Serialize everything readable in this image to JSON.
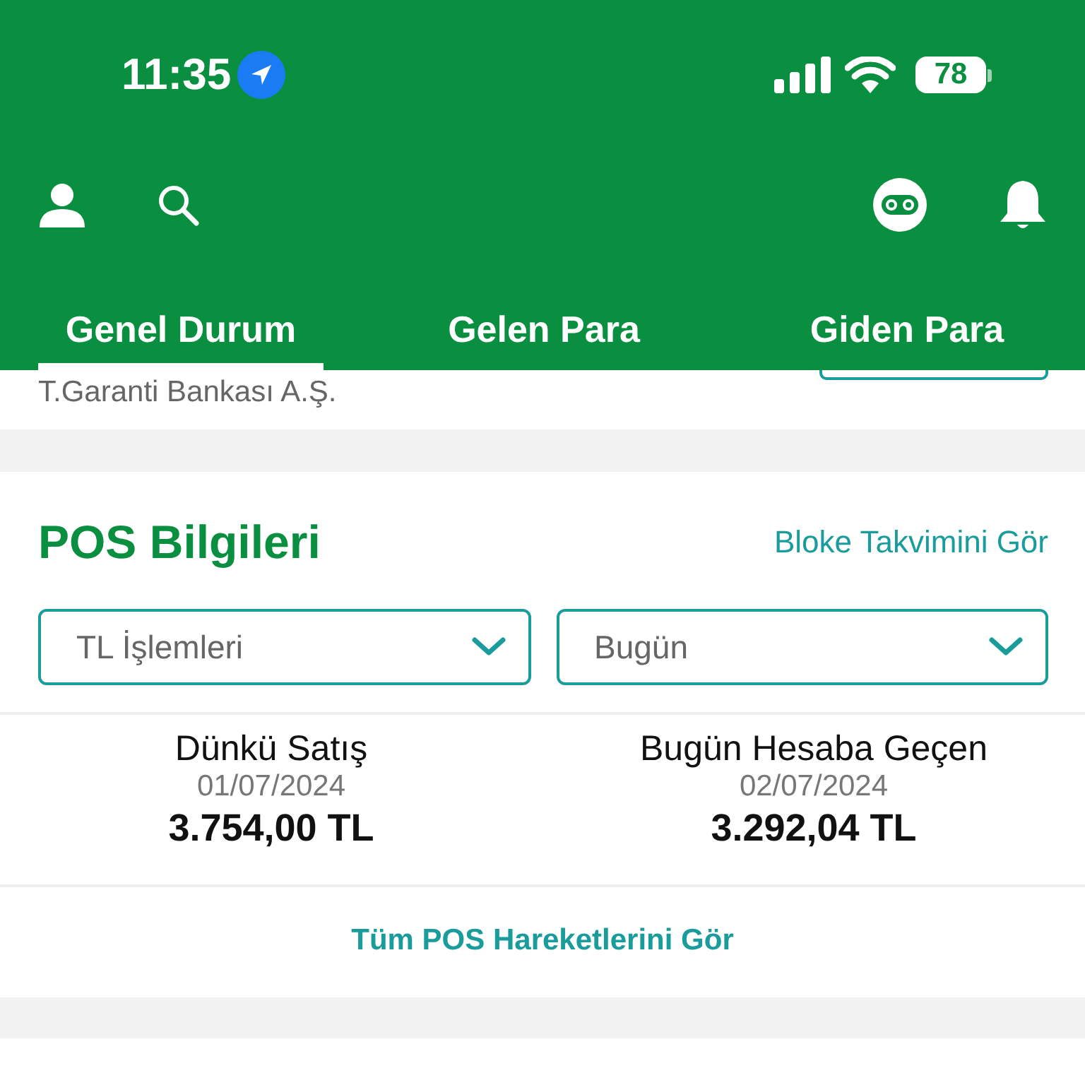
{
  "status_bar": {
    "time": "11:35",
    "battery": "78"
  },
  "tabs": [
    {
      "label": "Genel Durum",
      "selected": true
    },
    {
      "label": "Gelen Para",
      "selected": false
    },
    {
      "label": "Giden Para",
      "selected": false
    }
  ],
  "account": {
    "bank": "T.Garanti Bankası A.Ş."
  },
  "pos_card": {
    "title": "POS Bilgileri",
    "link": "Bloke Takvimini Gör",
    "dropdowns": [
      {
        "value": "TL İşlemleri"
      },
      {
        "value": "Bugün"
      }
    ],
    "summaries": [
      {
        "label": "Dünkü Satış",
        "date": "01/07/2024",
        "amount": "3.754,00 TL"
      },
      {
        "label": "Bugün Hesaba Geçen",
        "date": "02/07/2024",
        "amount": "3.292,04 TL"
      }
    ],
    "footer_link": "Tüm POS Hareketlerini Gör"
  }
}
